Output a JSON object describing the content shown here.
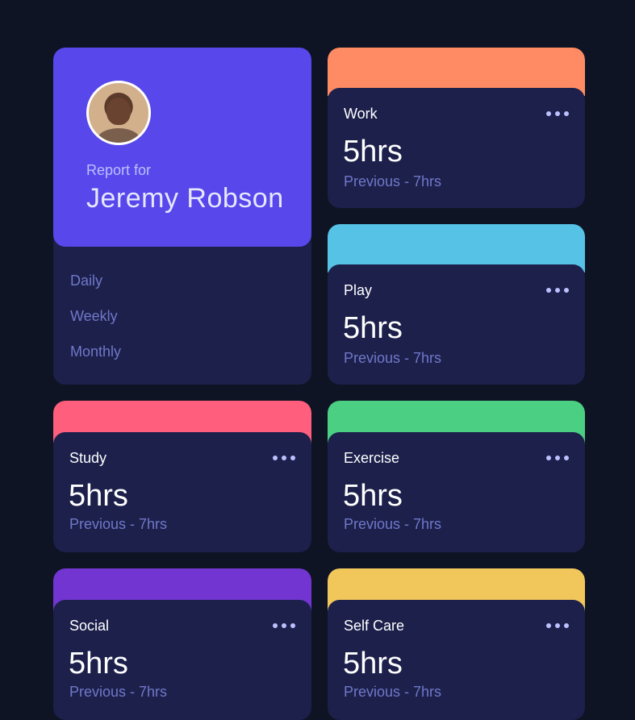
{
  "colors": {
    "background": "#0f1424",
    "card": "#1c204b",
    "profile_accent": "#5847eb",
    "work": "#ff8b64",
    "play": "#55c2e6",
    "study": "#ff5e7d",
    "exercise": "#4bcf82",
    "social": "#7335d2",
    "self_care": "#f1c75b"
  },
  "profile": {
    "avatar_icon": "user-avatar",
    "report_label": "Report for",
    "name": "Jeremy Robson",
    "periods": [
      "Daily",
      "Weekly",
      "Monthly"
    ]
  },
  "activities": [
    {
      "title": "Work",
      "current": "5hrs",
      "previous": "Previous - 7hrs",
      "icon": "ellipsis-icon"
    },
    {
      "title": "Play",
      "current": "5hrs",
      "previous": "Previous - 7hrs",
      "icon": "ellipsis-icon"
    },
    {
      "title": "Study",
      "current": "5hrs",
      "previous": "Previous - 7hrs",
      "icon": "ellipsis-icon"
    },
    {
      "title": "Exercise",
      "current": "5hrs",
      "previous": "Previous - 7hrs",
      "icon": "ellipsis-icon"
    },
    {
      "title": "Social",
      "current": "5hrs",
      "previous": "Previous - 7hrs",
      "icon": "ellipsis-icon"
    },
    {
      "title": "Self Care",
      "current": "5hrs",
      "previous": "Previous - 7hrs",
      "icon": "ellipsis-icon"
    }
  ]
}
